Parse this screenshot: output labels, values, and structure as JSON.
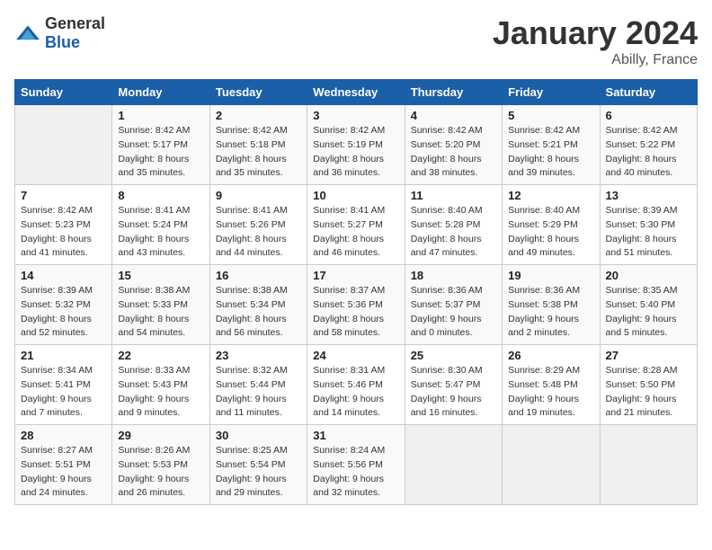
{
  "logo": {
    "text_general": "General",
    "text_blue": "Blue"
  },
  "title": "January 2024",
  "location": "Abilly, France",
  "days_of_week": [
    "Sunday",
    "Monday",
    "Tuesday",
    "Wednesday",
    "Thursday",
    "Friday",
    "Saturday"
  ],
  "weeks": [
    [
      {
        "day": "",
        "empty": true
      },
      {
        "day": "1",
        "sunrise": "Sunrise: 8:42 AM",
        "sunset": "Sunset: 5:17 PM",
        "daylight": "Daylight: 8 hours and 35 minutes."
      },
      {
        "day": "2",
        "sunrise": "Sunrise: 8:42 AM",
        "sunset": "Sunset: 5:18 PM",
        "daylight": "Daylight: 8 hours and 35 minutes."
      },
      {
        "day": "3",
        "sunrise": "Sunrise: 8:42 AM",
        "sunset": "Sunset: 5:19 PM",
        "daylight": "Daylight: 8 hours and 36 minutes."
      },
      {
        "day": "4",
        "sunrise": "Sunrise: 8:42 AM",
        "sunset": "Sunset: 5:20 PM",
        "daylight": "Daylight: 8 hours and 38 minutes."
      },
      {
        "day": "5",
        "sunrise": "Sunrise: 8:42 AM",
        "sunset": "Sunset: 5:21 PM",
        "daylight": "Daylight: 8 hours and 39 minutes."
      },
      {
        "day": "6",
        "sunrise": "Sunrise: 8:42 AM",
        "sunset": "Sunset: 5:22 PM",
        "daylight": "Daylight: 8 hours and 40 minutes."
      }
    ],
    [
      {
        "day": "7",
        "sunrise": "Sunrise: 8:42 AM",
        "sunset": "Sunset: 5:23 PM",
        "daylight": "Daylight: 8 hours and 41 minutes."
      },
      {
        "day": "8",
        "sunrise": "Sunrise: 8:41 AM",
        "sunset": "Sunset: 5:24 PM",
        "daylight": "Daylight: 8 hours and 43 minutes."
      },
      {
        "day": "9",
        "sunrise": "Sunrise: 8:41 AM",
        "sunset": "Sunset: 5:26 PM",
        "daylight": "Daylight: 8 hours and 44 minutes."
      },
      {
        "day": "10",
        "sunrise": "Sunrise: 8:41 AM",
        "sunset": "Sunset: 5:27 PM",
        "daylight": "Daylight: 8 hours and 46 minutes."
      },
      {
        "day": "11",
        "sunrise": "Sunrise: 8:40 AM",
        "sunset": "Sunset: 5:28 PM",
        "daylight": "Daylight: 8 hours and 47 minutes."
      },
      {
        "day": "12",
        "sunrise": "Sunrise: 8:40 AM",
        "sunset": "Sunset: 5:29 PM",
        "daylight": "Daylight: 8 hours and 49 minutes."
      },
      {
        "day": "13",
        "sunrise": "Sunrise: 8:39 AM",
        "sunset": "Sunset: 5:30 PM",
        "daylight": "Daylight: 8 hours and 51 minutes."
      }
    ],
    [
      {
        "day": "14",
        "sunrise": "Sunrise: 8:39 AM",
        "sunset": "Sunset: 5:32 PM",
        "daylight": "Daylight: 8 hours and 52 minutes."
      },
      {
        "day": "15",
        "sunrise": "Sunrise: 8:38 AM",
        "sunset": "Sunset: 5:33 PM",
        "daylight": "Daylight: 8 hours and 54 minutes."
      },
      {
        "day": "16",
        "sunrise": "Sunrise: 8:38 AM",
        "sunset": "Sunset: 5:34 PM",
        "daylight": "Daylight: 8 hours and 56 minutes."
      },
      {
        "day": "17",
        "sunrise": "Sunrise: 8:37 AM",
        "sunset": "Sunset: 5:36 PM",
        "daylight": "Daylight: 8 hours and 58 minutes."
      },
      {
        "day": "18",
        "sunrise": "Sunrise: 8:36 AM",
        "sunset": "Sunset: 5:37 PM",
        "daylight": "Daylight: 9 hours and 0 minutes."
      },
      {
        "day": "19",
        "sunrise": "Sunrise: 8:36 AM",
        "sunset": "Sunset: 5:38 PM",
        "daylight": "Daylight: 9 hours and 2 minutes."
      },
      {
        "day": "20",
        "sunrise": "Sunrise: 8:35 AM",
        "sunset": "Sunset: 5:40 PM",
        "daylight": "Daylight: 9 hours and 5 minutes."
      }
    ],
    [
      {
        "day": "21",
        "sunrise": "Sunrise: 8:34 AM",
        "sunset": "Sunset: 5:41 PM",
        "daylight": "Daylight: 9 hours and 7 minutes."
      },
      {
        "day": "22",
        "sunrise": "Sunrise: 8:33 AM",
        "sunset": "Sunset: 5:43 PM",
        "daylight": "Daylight: 9 hours and 9 minutes."
      },
      {
        "day": "23",
        "sunrise": "Sunrise: 8:32 AM",
        "sunset": "Sunset: 5:44 PM",
        "daylight": "Daylight: 9 hours and 11 minutes."
      },
      {
        "day": "24",
        "sunrise": "Sunrise: 8:31 AM",
        "sunset": "Sunset: 5:46 PM",
        "daylight": "Daylight: 9 hours and 14 minutes."
      },
      {
        "day": "25",
        "sunrise": "Sunrise: 8:30 AM",
        "sunset": "Sunset: 5:47 PM",
        "daylight": "Daylight: 9 hours and 16 minutes."
      },
      {
        "day": "26",
        "sunrise": "Sunrise: 8:29 AM",
        "sunset": "Sunset: 5:48 PM",
        "daylight": "Daylight: 9 hours and 19 minutes."
      },
      {
        "day": "27",
        "sunrise": "Sunrise: 8:28 AM",
        "sunset": "Sunset: 5:50 PM",
        "daylight": "Daylight: 9 hours and 21 minutes."
      }
    ],
    [
      {
        "day": "28",
        "sunrise": "Sunrise: 8:27 AM",
        "sunset": "Sunset: 5:51 PM",
        "daylight": "Daylight: 9 hours and 24 minutes."
      },
      {
        "day": "29",
        "sunrise": "Sunrise: 8:26 AM",
        "sunset": "Sunset: 5:53 PM",
        "daylight": "Daylight: 9 hours and 26 minutes."
      },
      {
        "day": "30",
        "sunrise": "Sunrise: 8:25 AM",
        "sunset": "Sunset: 5:54 PM",
        "daylight": "Daylight: 9 hours and 29 minutes."
      },
      {
        "day": "31",
        "sunrise": "Sunrise: 8:24 AM",
        "sunset": "Sunset: 5:56 PM",
        "daylight": "Daylight: 9 hours and 32 minutes."
      },
      {
        "day": "",
        "empty": true
      },
      {
        "day": "",
        "empty": true
      },
      {
        "day": "",
        "empty": true
      }
    ]
  ]
}
